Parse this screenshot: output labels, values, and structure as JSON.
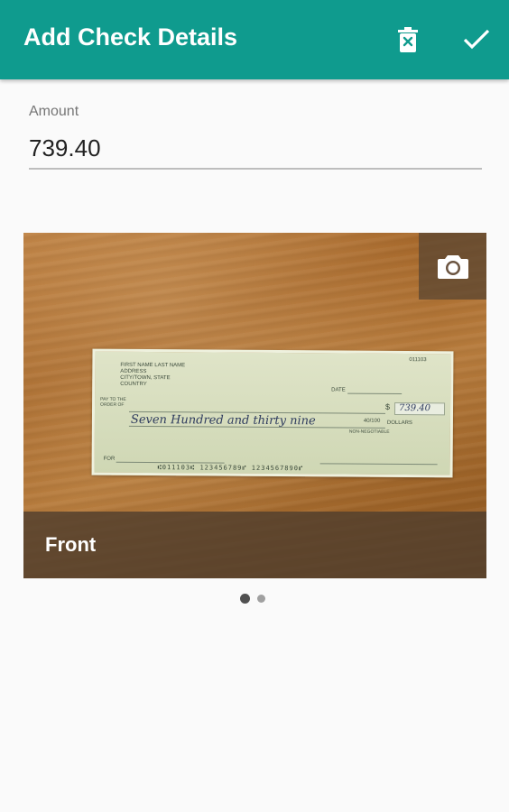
{
  "appbar": {
    "title": "Add Check Details",
    "background": "#0f9b8e",
    "delete_icon": "trash-x-icon",
    "done_icon": "check-icon"
  },
  "amount": {
    "label": "Amount",
    "value": "739.40"
  },
  "image_pager": {
    "camera_icon": "camera-icon",
    "caption": "Front",
    "page_count": 2,
    "current_page": 1,
    "check_preview": {
      "name_line": "FIRST NAME LAST NAME",
      "address_line": "ADDRESS",
      "city_line": "CITY/TOWN, STATE",
      "country_line": "COUNTRY",
      "check_number": "011103",
      "date_label": "DATE",
      "pay_label": "PAY TO THE ORDER OF",
      "amount_written": "Seven Hundred and thirty nine",
      "amount_fraction": "40/100",
      "dollars_label": "DOLLARS",
      "amount_numeric": "739.40",
      "non_negotiable": "NON-NEGOTIABLE",
      "for_label": "FOR",
      "micr": "⑆011103⑆ 123456789⑈ 1234567890⑈"
    }
  }
}
